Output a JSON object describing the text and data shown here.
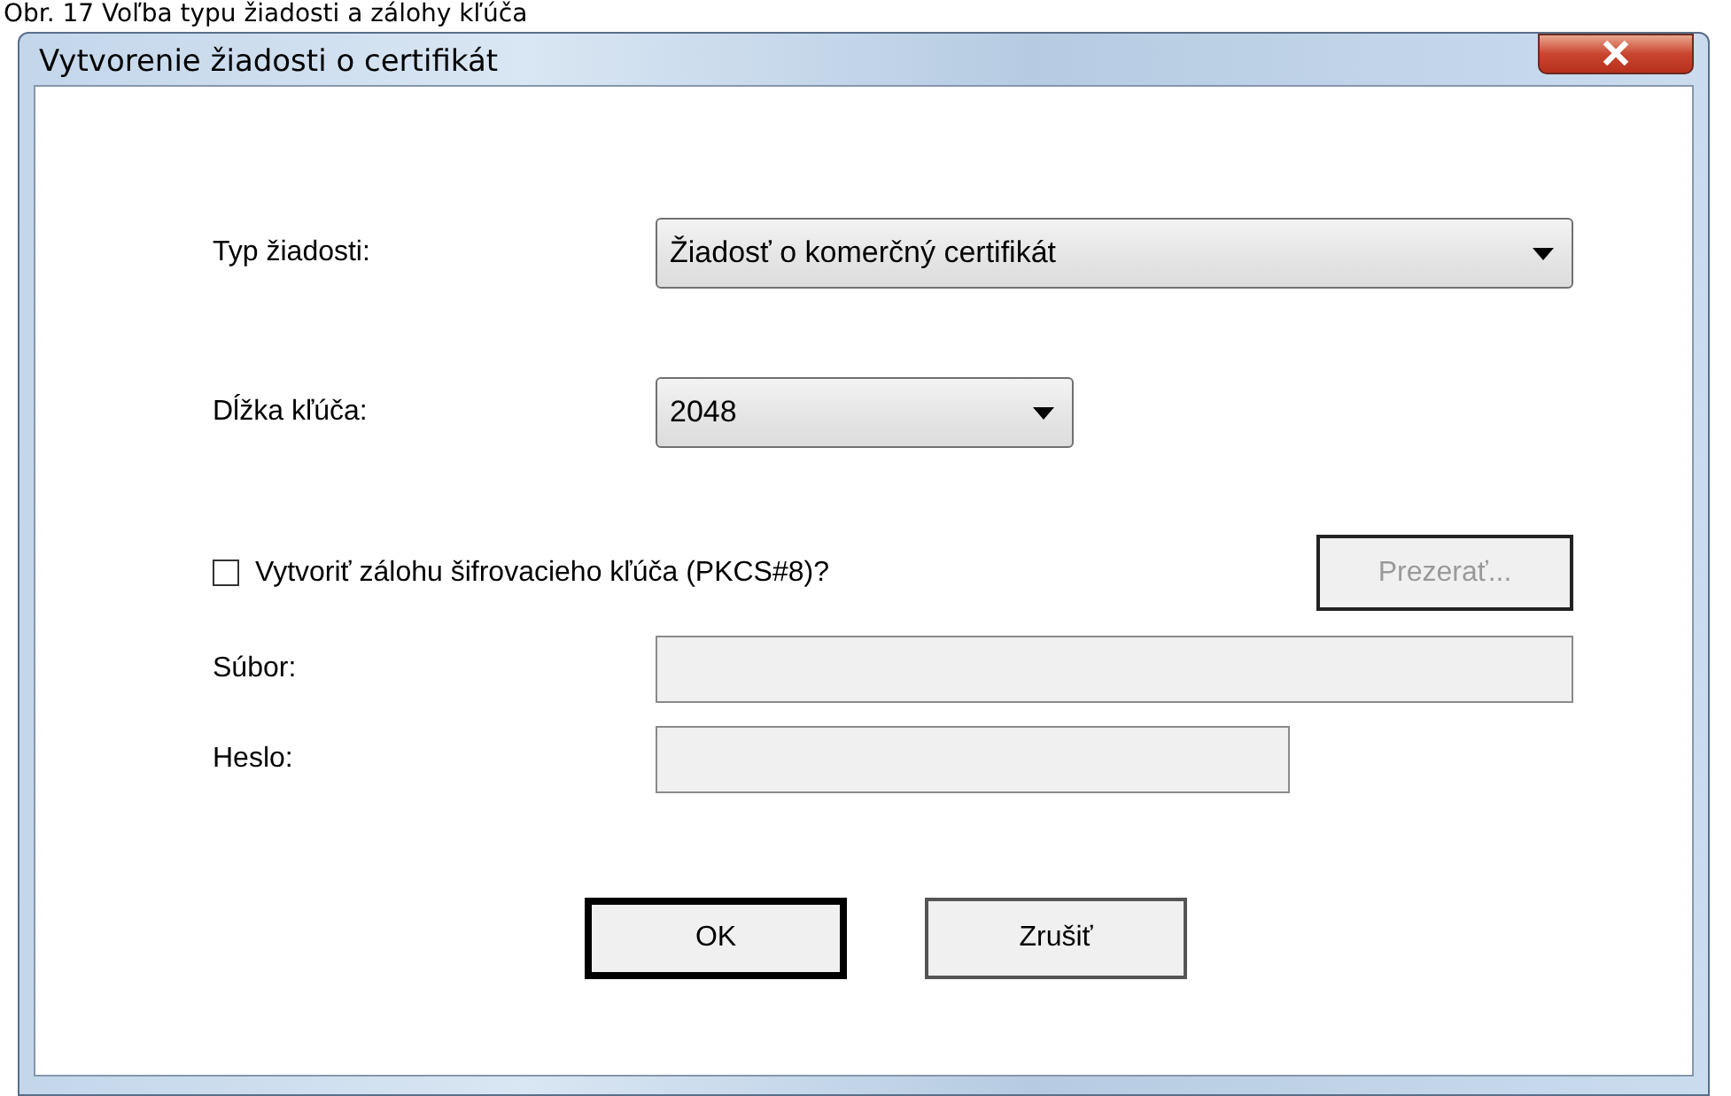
{
  "caption": "Obr. 17 Voľba typu žiadosti a zálohy kľúča",
  "window": {
    "title": "Vytvorenie žiadosti o certifikát"
  },
  "request_type": {
    "label": "Typ žiadosti:",
    "value": "Žiadosť o komerčný certifikát"
  },
  "key_length": {
    "label": "Dĺžka kľúča:",
    "value": "2048"
  },
  "backup": {
    "label": "Vytvoriť zálohu šifrovacieho kľúča (PKCS#8)?",
    "checked": false
  },
  "browse_button": {
    "label": "Prezerať...",
    "disabled": true
  },
  "file_field": {
    "label": "Súbor:",
    "disabled": true
  },
  "password_field": {
    "label": "Heslo:",
    "disabled": true
  },
  "buttons": [
    {
      "label": "OK",
      "default": true
    },
    {
      "label": "Zrušiť",
      "default": false
    }
  ]
}
